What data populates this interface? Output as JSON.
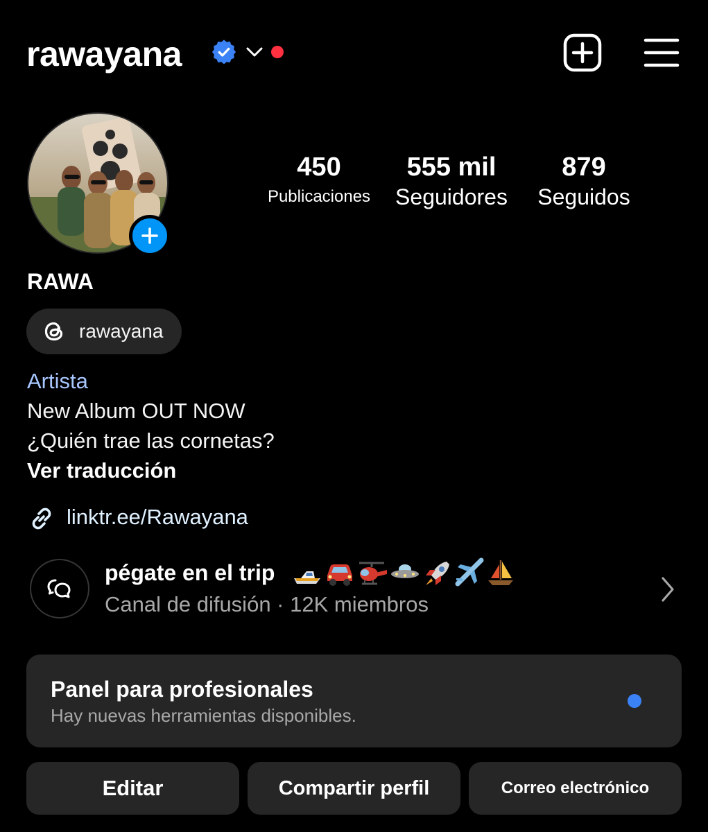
{
  "header": {
    "username": "rawayana"
  },
  "profile": {
    "stats": [
      {
        "value": "450",
        "label": "Publicaciones"
      },
      {
        "value": "555 mil",
        "label": "Seguidores"
      },
      {
        "value": "879",
        "label": "Seguidos"
      }
    ],
    "display_name": "RAWA",
    "threads_handle": "rawayana",
    "bio": {
      "category": "Artista",
      "line1": "New Album OUT NOW",
      "line2": "¿Quién trae las cornetas?",
      "translate": "Ver traducción"
    },
    "link": "linktr.ee/Rawayana"
  },
  "channel": {
    "title": "pégate en el trip",
    "emojis": [
      "speedboat",
      "car",
      "helicopter",
      "flying-saucer",
      "rocket",
      "airplane",
      "sailboat"
    ],
    "subtitle": "Canal de difusión · 12K miembros"
  },
  "pro_panel": {
    "title": "Panel para profesionales",
    "subtitle": "Hay nuevas herramientas disponibles."
  },
  "actions": {
    "edit": "Editar",
    "share": "Compartir perfil",
    "email": "Correo electrónico"
  },
  "colors": {
    "background": "#000000",
    "surface": "#262626",
    "verified": "#3b82f6",
    "notification": "#ff3040",
    "add_button": "#0095f6",
    "secondary_text": "#a8a8a8"
  }
}
